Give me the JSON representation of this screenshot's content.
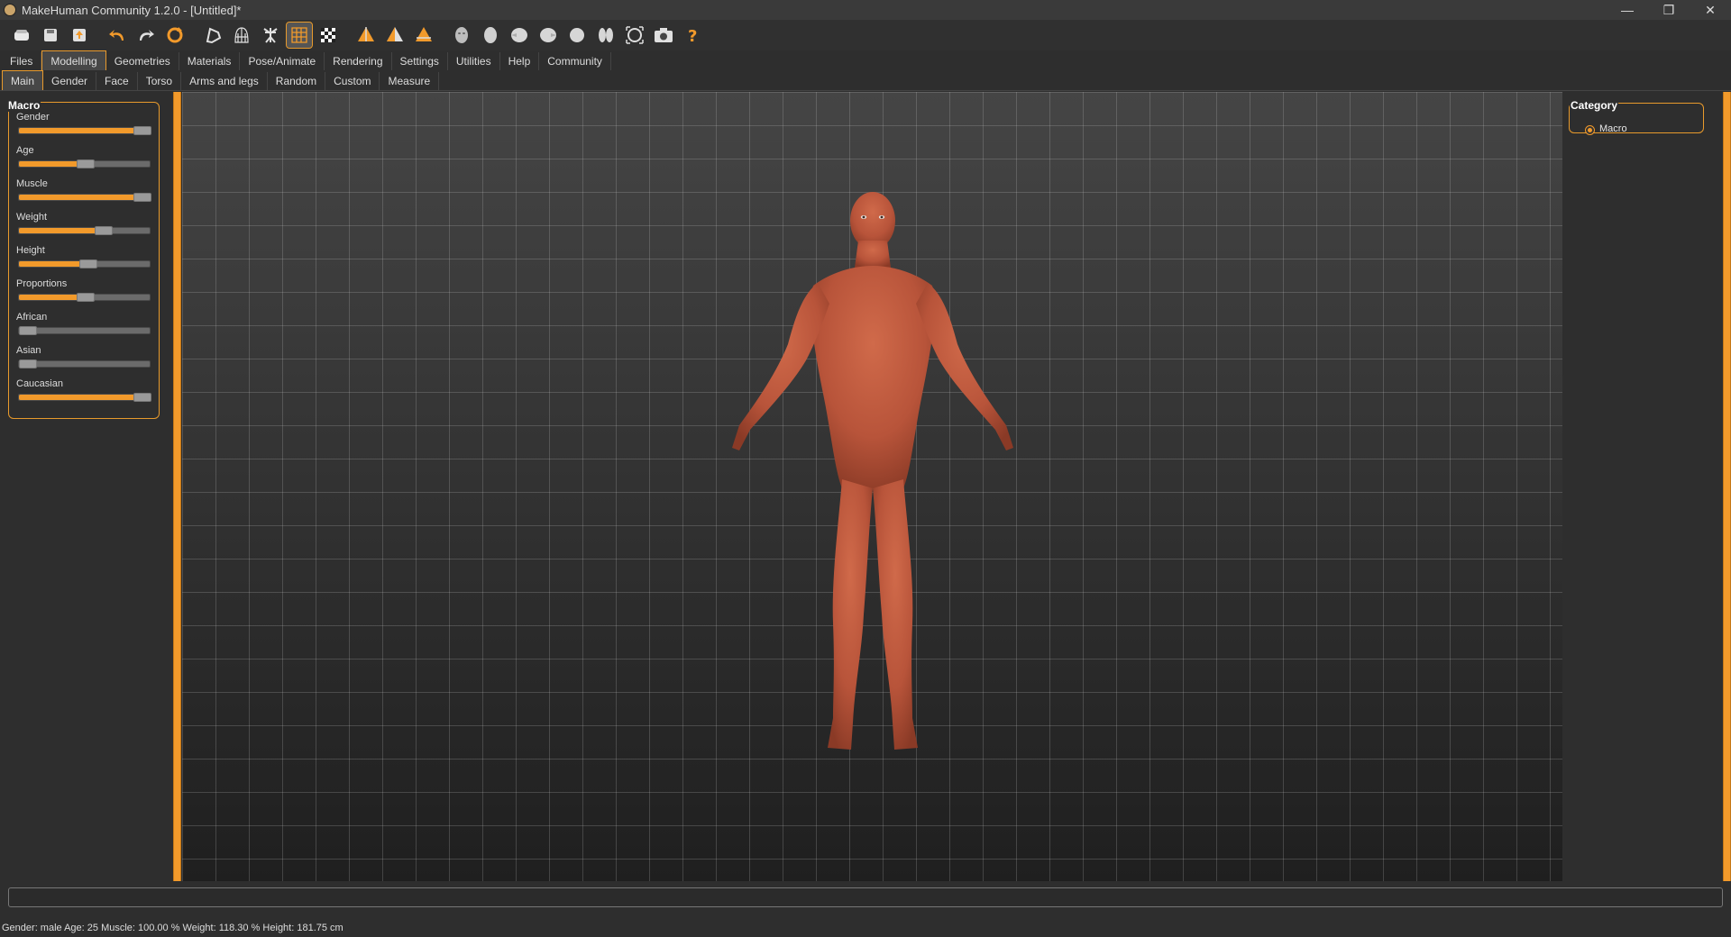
{
  "window": {
    "title": "MakeHuman Community 1.2.0 - [Untitled]*"
  },
  "toolbar": {
    "icons": [
      "new-icon",
      "save-icon",
      "export-icon",
      "undo-icon",
      "redo-icon",
      "reset-icon",
      "smooth-icon",
      "wireframe-icon",
      "skeleton-icon",
      "grid-icon",
      "checker-icon",
      "front-view-icon",
      "back-view-icon",
      "side-view-icon",
      "face-icon",
      "head-icon",
      "left-view-icon",
      "right-view-icon",
      "top-view-icon",
      "bottom-view-icon",
      "reset-camera-icon",
      "screenshot-icon",
      "help-icon"
    ]
  },
  "main_tabs": [
    {
      "label": "Files"
    },
    {
      "label": "Modelling",
      "active": true
    },
    {
      "label": "Geometries"
    },
    {
      "label": "Materials"
    },
    {
      "label": "Pose/Animate"
    },
    {
      "label": "Rendering"
    },
    {
      "label": "Settings"
    },
    {
      "label": "Utilities"
    },
    {
      "label": "Help"
    },
    {
      "label": "Community"
    }
  ],
  "sub_tabs": [
    {
      "label": "Main",
      "active": true
    },
    {
      "label": "Gender"
    },
    {
      "label": "Face"
    },
    {
      "label": "Torso"
    },
    {
      "label": "Arms and legs"
    },
    {
      "label": "Random"
    },
    {
      "label": "Custom"
    },
    {
      "label": "Measure"
    }
  ],
  "macro": {
    "title": "Macro",
    "sliders": [
      {
        "label": "Gender",
        "value": 1.0
      },
      {
        "label": "Age",
        "value": 0.5
      },
      {
        "label": "Muscle",
        "value": 1.0
      },
      {
        "label": "Weight",
        "value": 0.66
      },
      {
        "label": "Height",
        "value": 0.53
      },
      {
        "label": "Proportions",
        "value": 0.5
      },
      {
        "label": "African",
        "value": 0.0
      },
      {
        "label": "Asian",
        "value": 0.0
      },
      {
        "label": "Caucasian",
        "value": 1.0
      }
    ]
  },
  "category": {
    "title": "Category",
    "option": "Macro"
  },
  "statusbar": {
    "text": "Gender: male  Age: 25  Muscle: 100.00 %  Weight: 118.30 %  Height: 181.75 cm"
  },
  "colors": {
    "accent": "#f29a2b",
    "skin": "#c0593b"
  }
}
